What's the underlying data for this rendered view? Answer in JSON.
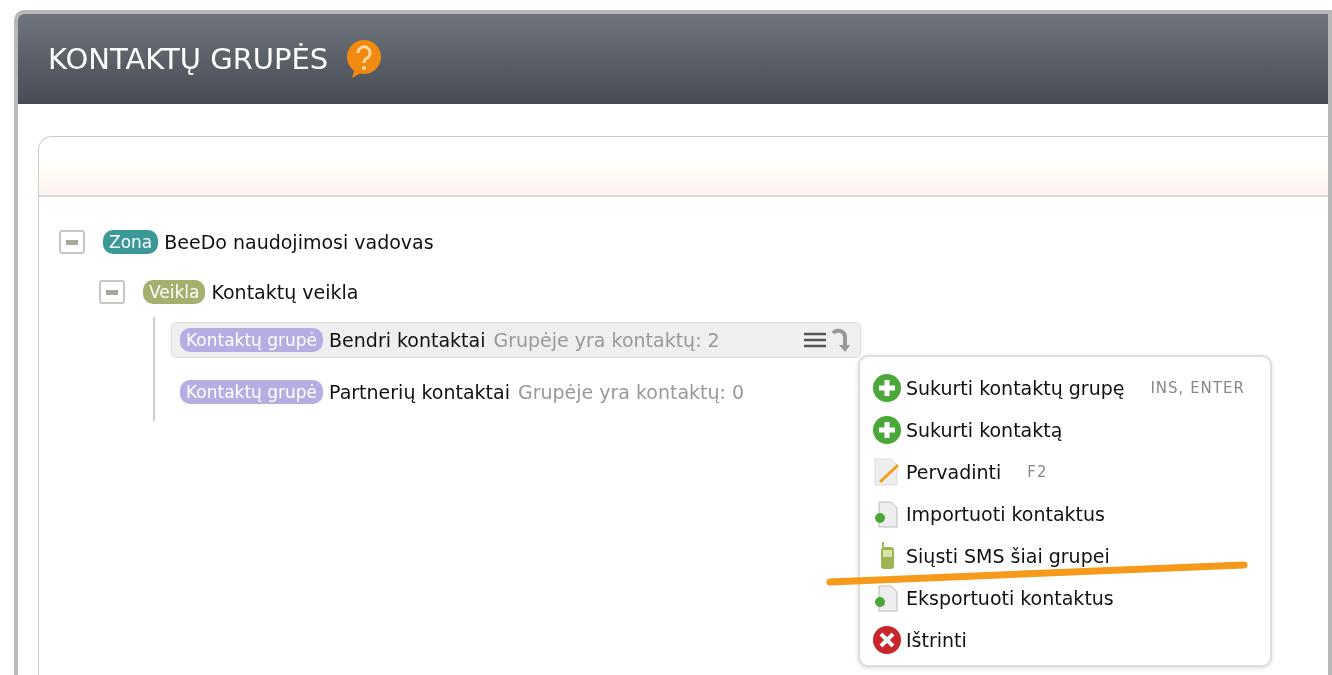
{
  "window": {
    "title": "KONTAKTŲ GRUPĖS"
  },
  "tree": [
    {
      "badge": "Zona",
      "kind": "zone",
      "label": "BeeDo naudojimosi vadovas",
      "expanded": true,
      "children": [
        {
          "badge": "Veikla",
          "kind": "activity",
          "label": "Kontaktų veikla",
          "expanded": true,
          "children": [
            {
              "badge": "Kontaktų grupė",
              "kind": "group",
              "label": "Bendri kontaktai",
              "note": "Grupėje yra kontaktų: 2",
              "selected": true
            },
            {
              "badge": "Kontaktų grupė",
              "kind": "group",
              "label": "Partnerių kontaktai",
              "note": "Grupėje yra kontaktų: 0",
              "selected": false
            }
          ]
        }
      ]
    }
  ],
  "context_menu": [
    {
      "kind": "add",
      "label": "Sukurti kontaktų grupę",
      "shortcut": "INS, ENTER"
    },
    {
      "kind": "add",
      "label": "Sukurti kontaktą"
    },
    {
      "kind": "rename",
      "label": "Pervadinti",
      "shortcut": "F2"
    },
    {
      "kind": "import",
      "label": "Importuoti kontaktus"
    },
    {
      "kind": "sms",
      "label": "Siųsti SMS šiai grupei",
      "highlighted": true
    },
    {
      "kind": "import",
      "label": "Eksportuoti kontaktus"
    },
    {
      "kind": "delete",
      "label": "Ištrinti"
    }
  ]
}
